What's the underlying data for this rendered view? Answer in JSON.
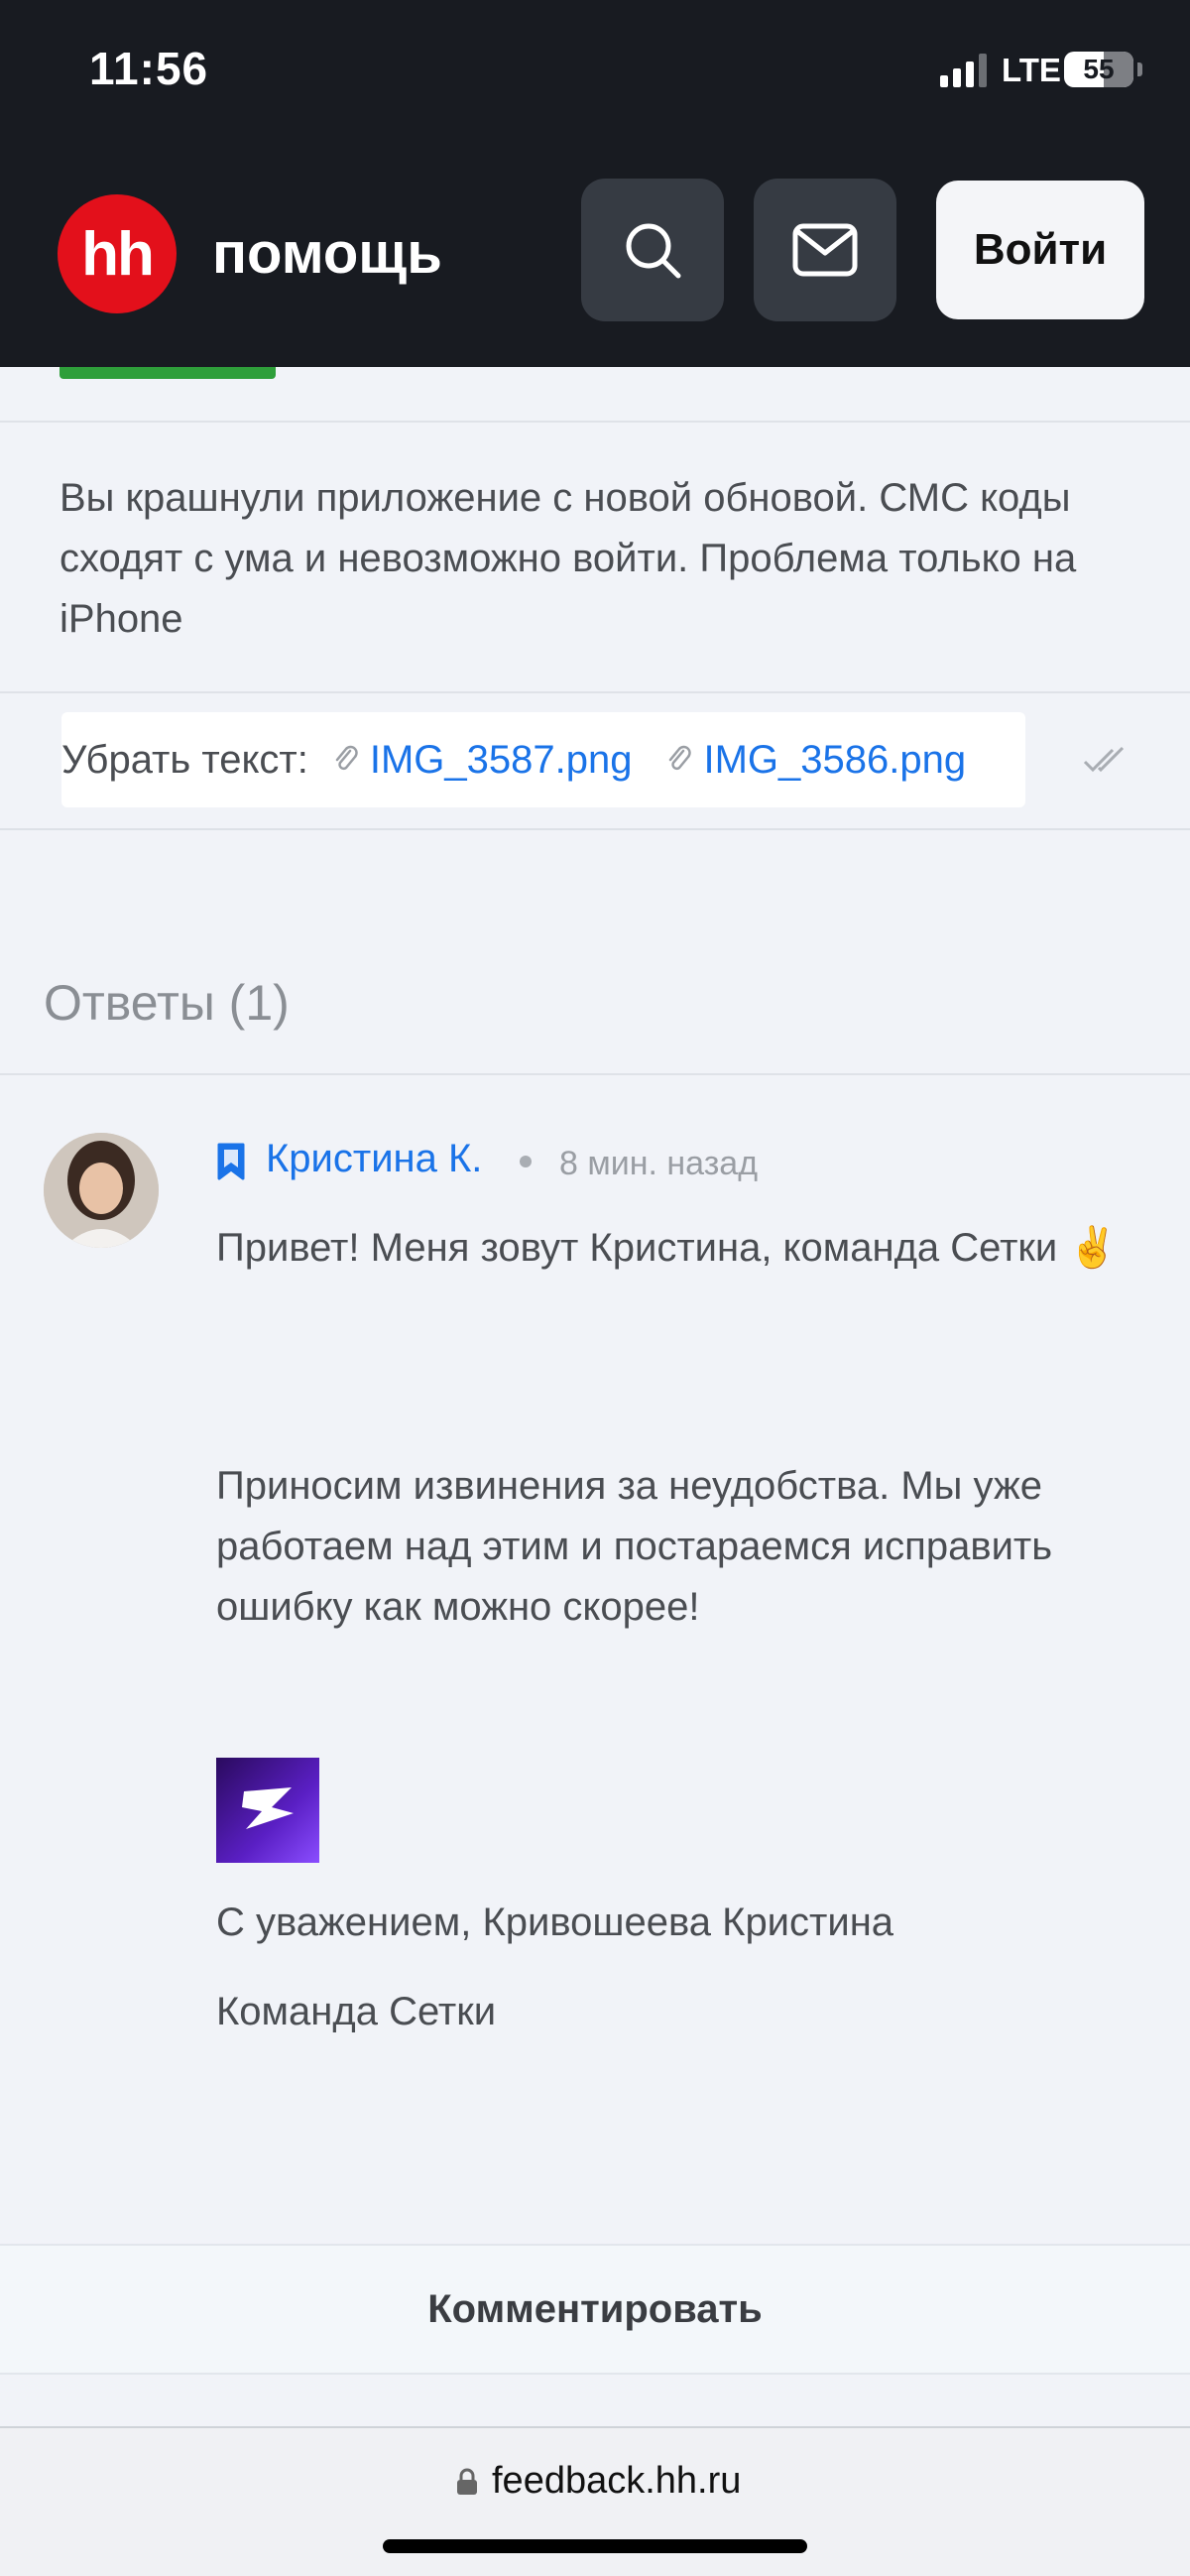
{
  "status_bar": {
    "time": "11:56",
    "network": "LTE",
    "battery": "55"
  },
  "header": {
    "logo_text": "hh",
    "brand": "помощь",
    "search_icon": "search-icon",
    "mail_icon": "mail-icon",
    "login_label": "Войти"
  },
  "question": {
    "text": "Вы крашнули приложение с новой обновой. СМС коды сходят с ума и невозможно войти. Проблема только на iPhone",
    "attachments_label": "Убрать текст:",
    "attachments": [
      "IMG_3587.png",
      "IMG_3586.png"
    ]
  },
  "answers": {
    "title": "Ответы (1)",
    "items": [
      {
        "author": "Кристина К.",
        "time": "8 мин. назад",
        "paragraphs": [
          "Привет! Меня зовут Кристина, команда Сетки ✌️",
          "Приносим извинения за неудобства. Мы уже работаем над этим и постараемся исправить ошибку как можно скорее!",
          "С уважением, Кривошеева Кристина",
          "Команда Сетки"
        ]
      }
    ]
  },
  "comment_button": "Комментировать",
  "browser": {
    "url": "feedback.hh.ru"
  },
  "colors": {
    "header_bg": "#181b21",
    "brand_red": "#e3101b",
    "link_blue": "#1a73e8",
    "accent_green": "#2e9f3a"
  }
}
